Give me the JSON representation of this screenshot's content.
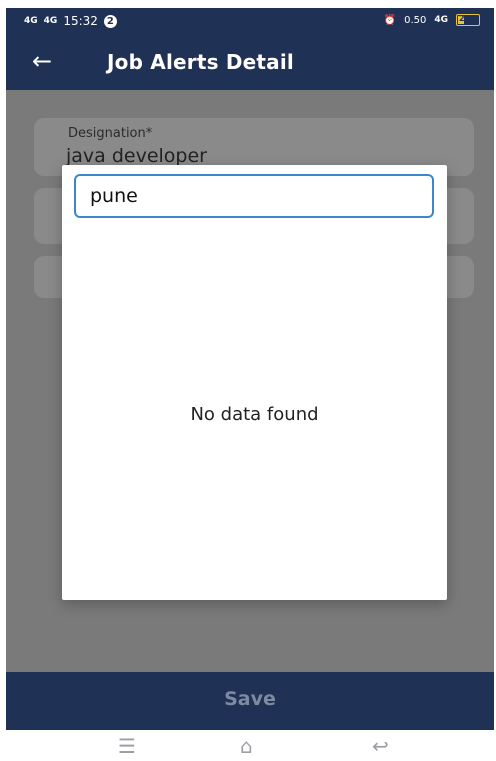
{
  "status_bar": {
    "signal_1": "4G",
    "signal_2": "4G",
    "time": "15:32",
    "notification_count": "2",
    "network_type": "4G",
    "data_speed": "0.50",
    "battery_level": "25"
  },
  "app_bar": {
    "title": "Job Alerts Detail"
  },
  "form": {
    "designation": {
      "label": "Designation*",
      "value": "java developer"
    }
  },
  "dialog": {
    "search_value": "pune",
    "empty_message": "No data found"
  },
  "footer": {
    "save_label": "Save"
  },
  "colors": {
    "primary": "#1f3154",
    "input_focus": "#3b87c9",
    "overlay": "#7a7a7a"
  }
}
